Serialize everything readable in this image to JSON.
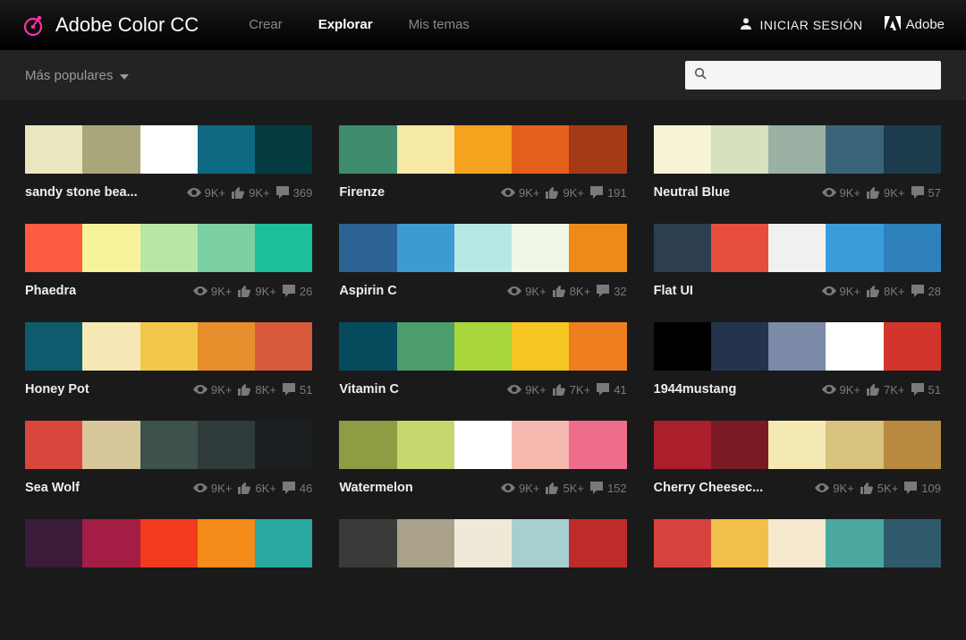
{
  "header": {
    "brand": "Adobe Color CC",
    "nav": {
      "create": "Crear",
      "explore": "Explorar",
      "mythemes": "Mis temas"
    },
    "signin": "INICIAR SESIÓN",
    "adobe": "Adobe"
  },
  "filter": {
    "label": "Más populares"
  },
  "search": {
    "placeholder": ""
  },
  "palettes": [
    {
      "name": "sandy stone bea...",
      "views": "9K+",
      "likes": "9K+",
      "comments": "369",
      "colors": [
        "#e9e6c0",
        "#a9a77a",
        "#ffffff",
        "#0e6a82",
        "#043b40"
      ]
    },
    {
      "name": "Firenze",
      "views": "9K+",
      "likes": "9K+",
      "comments": "191",
      "colors": [
        "#3f8c6f",
        "#f6e9a8",
        "#f5a31f",
        "#e45f1c",
        "#a63a17"
      ]
    },
    {
      "name": "Neutral Blue",
      "views": "9K+",
      "likes": "9K+",
      "comments": "57",
      "colors": [
        "#f6f4d5",
        "#d7e0bf",
        "#99b0a3",
        "#3c6478",
        "#1c3b4d"
      ]
    },
    {
      "name": "Phaedra",
      "views": "9K+",
      "likes": "9K+",
      "comments": "26",
      "colors": [
        "#ff5b42",
        "#f7f39b",
        "#b8e7a5",
        "#7bcfa2",
        "#1dbf9a"
      ]
    },
    {
      "name": "Aspirin C",
      "views": "9K+",
      "likes": "8K+",
      "comments": "32",
      "colors": [
        "#2b6494",
        "#3d9bd1",
        "#b7e8e4",
        "#f1f7e6",
        "#ed8b19"
      ]
    },
    {
      "name": "Flat UI",
      "views": "9K+",
      "likes": "8K+",
      "comments": "28",
      "colors": [
        "#2d3e50",
        "#e54e3e",
        "#f0f0ee",
        "#3a9dd9",
        "#2d80ba"
      ]
    },
    {
      "name": "Honey Pot",
      "views": "9K+",
      "likes": "8K+",
      "comments": "51",
      "colors": [
        "#0f5b6e",
        "#f5e8b4",
        "#f2c84b",
        "#e78f2c",
        "#d75a3c"
      ]
    },
    {
      "name": "Vitamin C",
      "views": "9K+",
      "likes": "7K+",
      "comments": "41",
      "colors": [
        "#064a5e",
        "#4b9e6c",
        "#a9d63b",
        "#f6c521",
        "#ee7e1e"
      ]
    },
    {
      "name": "1944mustang",
      "views": "9K+",
      "likes": "7K+",
      "comments": "51",
      "colors": [
        "#000000",
        "#24344d",
        "#7a8aa7",
        "#ffffff",
        "#d1352b"
      ]
    },
    {
      "name": "Sea Wolf",
      "views": "9K+",
      "likes": "6K+",
      "comments": "46",
      "colors": [
        "#d9463d",
        "#d7c79a",
        "#3e514a",
        "#2f3a3a",
        "#1d2022"
      ]
    },
    {
      "name": "Watermelon",
      "views": "9K+",
      "likes": "5K+",
      "comments": "152",
      "colors": [
        "#8f9c44",
        "#c5d86d",
        "#ffffff",
        "#f6b9b0",
        "#ee6d8a"
      ]
    },
    {
      "name": "Cherry Cheesec...",
      "views": "9K+",
      "likes": "5K+",
      "comments": "109",
      "colors": [
        "#ab1e2b",
        "#7a1a24",
        "#f4e8b3",
        "#d7c27e",
        "#b88a3f"
      ]
    },
    {
      "name": "",
      "views": "",
      "likes": "",
      "comments": "",
      "colors": [
        "#3a1b3a",
        "#a31d44",
        "#f23a1d",
        "#f48c1a",
        "#2aa9a0"
      ]
    },
    {
      "name": "",
      "views": "",
      "likes": "",
      "comments": "",
      "colors": [
        "#3a3a38",
        "#a9a18a",
        "#f1e9d8",
        "#a8cfd0",
        "#bf2a2a"
      ]
    },
    {
      "name": "",
      "views": "",
      "likes": "",
      "comments": "",
      "colors": [
        "#d7423d",
        "#f0c04a",
        "#f5e9cf",
        "#4aa8a0",
        "#2e5a6b"
      ]
    }
  ]
}
